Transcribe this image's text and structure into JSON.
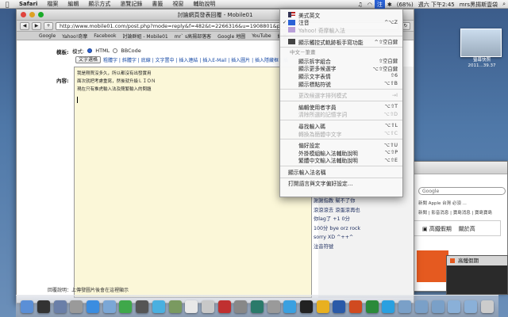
{
  "menubar": {
    "app": "Safari",
    "items": [
      "檔案",
      "編輯",
      "顯示方式",
      "瀏覽記錄",
      "書籤",
      "視窗",
      "輔助說明"
    ],
    "status": {
      "battery": "(68%)",
      "clock": "週六 下午2:45",
      "user": "mrs黑揚斯壹袋"
    }
  },
  "browser": {
    "title": "討論網頁發表回覆 - Mobile01",
    "url": "http://www.mobile01.com/post.php?mode=reply&f=482&t=2266316&u=1908801&p=1",
    "bookmarks": [
      "Google",
      "Yahoo!奇摩",
      "Facebook",
      "討論群組 - Mobile01",
      "mr` s高揚部落客",
      "Google 地圖",
      "YouTube",
      "維基"
    ]
  },
  "form": {
    "mode_label": "模式:",
    "label_mode_row": "模板:",
    "mode_html": "HTML",
    "mode_bbcode": "BBCode",
    "size_select": "文字選格",
    "format_links": "粗體字 | 斜體字 | 底線 | 文字置中 | 插入連結 | 插入E-Mail | 插入圖片 | 插入隱藏框 | 插",
    "content_label": "內容:",
    "editor_lines": [
      "我是剛買沒多久，所以都沒有出發實用",
      "面次就把考慮重寫，然後就升級ＬＩＯＮ",
      "現在只有推虎輸入法及簡繁輸入的問題"
    ],
    "bottom_text": "回覆說明：上傳發圖片後會在這裡顯示"
  },
  "input_menu": {
    "items": [
      {
        "label": "美式英文",
        "shortcut": "",
        "checked": false,
        "icon": "us-flag-icon",
        "dim": false
      },
      {
        "label": "注音",
        "shortcut": "^⌥Z",
        "checked": true,
        "icon": "zhuyin-icon",
        "dim": false
      },
      {
        "label": "Yahoo! 奇摩輸入法",
        "shortcut": "",
        "checked": false,
        "icon": "yahoo-icon",
        "dim": true
      }
    ],
    "show_palette": {
      "label": "顯示觸控式軌跡板手寫功能",
      "shortcut": "^⇧空白鍵"
    },
    "group_heading": "中文－筆畫",
    "group_items": [
      {
        "label": "顯示拆字組合",
        "shortcut": "⇧空白鍵"
      },
      {
        "label": "顯示更多候選字",
        "shortcut": "⌥⇧空白鍵"
      },
      {
        "label": "顯示文字表情",
        "shortcut": "⇧6"
      },
      {
        "label": "顯示標點符號",
        "shortcut": "⌥⇧B"
      }
    ],
    "change_mode": {
      "label": "更改候選字排列模式",
      "shortcut": "→I"
    },
    "dict_items": [
      {
        "label": "編輯使用者字員",
        "shortcut": "⌥⇧T",
        "dim": false
      },
      {
        "label": "清除所選的記憶字詞",
        "shortcut": "⌥⇧D",
        "dim": true
      }
    ],
    "lookup_items": [
      {
        "label": "尋找輸入碼",
        "shortcut": "⌥⇧L",
        "dim": false
      },
      {
        "label": "轉換為簡體中文字",
        "shortcut": "⌥⇧C",
        "dim": true
      }
    ],
    "pref_items": [
      {
        "label": "偏好設定",
        "shortcut": "⌥⇧U"
      },
      {
        "label": "外掛模組輸入法輔助說明",
        "shortcut": "⌥⇧P"
      },
      {
        "label": "繁體中文輸入法輔助說明",
        "shortcut": "⌥⇧E"
      }
    ],
    "show_name": "顯示輸入法名稱",
    "open_prefs": "打開語言與文字偏好設定…"
  },
  "desktop": {
    "cal_caption": "螢幕快照\n2011...39.37",
    "search_placeholder": "Google",
    "tabs_row": "新聞   Apple 台灣   必須 ...",
    "tabs_row2": "新聞 | 影音消息 | 寶島消息 | 寶島寶島",
    "ad_text": "高鐵假期",
    "ad_text2": "關於高",
    "winB_title": "高鐵假期",
    "chat_lines": [
      "謝謝指教   幫不了你",
      "滾滾滾去   滾蛋滾再也",
      "你lag了   +1   0分",
      "100分   bye   orz   rock",
      "sorry   XD   ^++^",
      "注音符號"
    ]
  },
  "dock": {
    "icons": [
      "finder-icon",
      "dashboard-icon",
      "mission-control-icon",
      "launchpad-icon",
      "safari-icon",
      "mail-icon",
      "ichat-icon",
      "facetime-icon",
      "itunes-icon",
      "iphoto-icon",
      "calendar-icon",
      "preview-icon",
      "photo-booth-icon",
      "dictionary-icon",
      "time-machine-icon",
      "system-preferences-icon",
      "app-store-icon",
      "terminal-icon",
      "chrome-icon",
      "word-icon",
      "powerpoint-icon",
      "excel-icon",
      "skype-icon",
      "folder-icon",
      "folder-icon",
      "folder-icon",
      "downloads-icon",
      "documents-icon",
      "trash-icon"
    ]
  },
  "colors": {
    "accent": "#2a62d6",
    "editor_bg": "#fbf7d8"
  }
}
